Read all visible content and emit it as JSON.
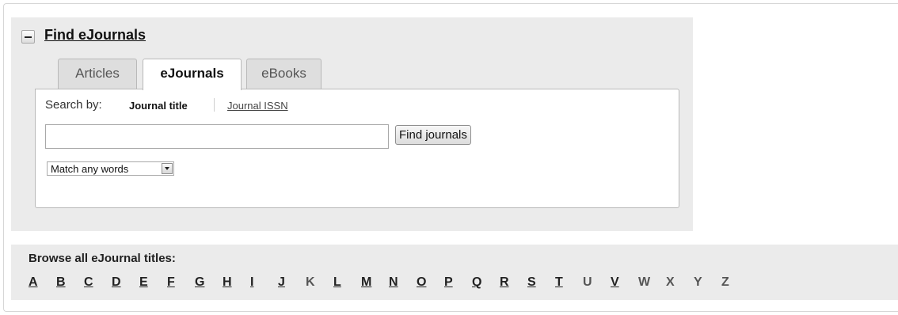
{
  "panel": {
    "title": "Find eJournals"
  },
  "tabs": [
    {
      "label": "Articles",
      "active": false
    },
    {
      "label": "eJournals",
      "active": true
    },
    {
      "label": "eBooks",
      "active": false
    }
  ],
  "search": {
    "by_label": "Search by:",
    "by_active": "Journal title",
    "by_other": "Journal ISSN",
    "input_value": "",
    "button_label": "Find journals",
    "match_selected": "Match any words"
  },
  "browse": {
    "title": "Browse all eJournal titles:",
    "letters": [
      {
        "l": "A",
        "link": true
      },
      {
        "l": "B",
        "link": true
      },
      {
        "l": "C",
        "link": true
      },
      {
        "l": "D",
        "link": true
      },
      {
        "l": "E",
        "link": true
      },
      {
        "l": "F",
        "link": true
      },
      {
        "l": "G",
        "link": true
      },
      {
        "l": "H",
        "link": true
      },
      {
        "l": "I",
        "link": true
      },
      {
        "l": "J",
        "link": true
      },
      {
        "l": "K",
        "link": false
      },
      {
        "l": "L",
        "link": true
      },
      {
        "l": "M",
        "link": true
      },
      {
        "l": "N",
        "link": true
      },
      {
        "l": "O",
        "link": true
      },
      {
        "l": "P",
        "link": true
      },
      {
        "l": "Q",
        "link": true
      },
      {
        "l": "R",
        "link": true
      },
      {
        "l": "S",
        "link": true
      },
      {
        "l": "T",
        "link": true
      },
      {
        "l": "U",
        "link": false
      },
      {
        "l": "V",
        "link": true
      },
      {
        "l": "W",
        "link": false
      },
      {
        "l": "X",
        "link": false
      },
      {
        "l": "Y",
        "link": false
      },
      {
        "l": "Z",
        "link": false
      }
    ]
  },
  "icons": {
    "collapse": "minus-icon",
    "select": "chevron-down-icon"
  }
}
